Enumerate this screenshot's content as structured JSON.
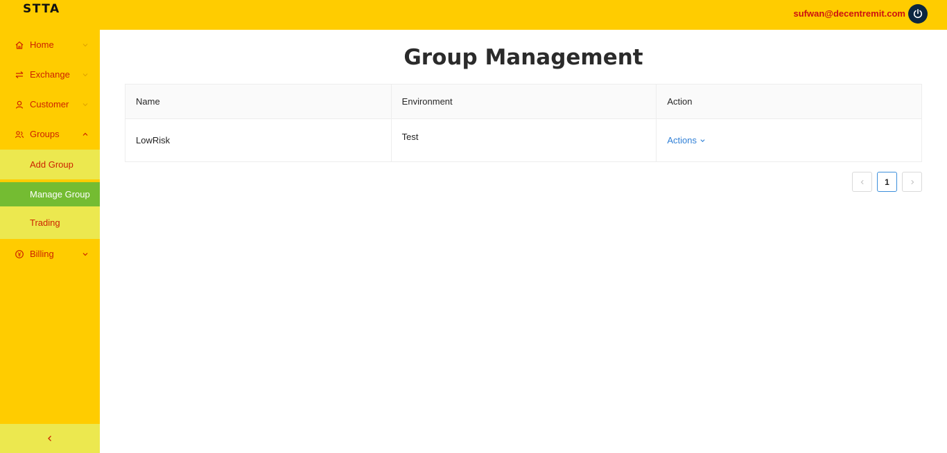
{
  "header": {
    "logo": "STTA",
    "user_email": "sufwan@decentremit.com"
  },
  "sidebar": {
    "items": [
      {
        "label": "Home",
        "icon": "home-icon"
      },
      {
        "label": "Exchange",
        "icon": "exchange-icon"
      },
      {
        "label": "Customer",
        "icon": "user-icon"
      },
      {
        "label": "Groups",
        "icon": "group-icon",
        "expanded": true,
        "children": [
          {
            "label": "Add Group"
          },
          {
            "label": "Manage Group",
            "active": true
          },
          {
            "label": "Trading"
          }
        ]
      },
      {
        "label": "Billing",
        "icon": "billing-icon"
      }
    ]
  },
  "main": {
    "title": "Group Management",
    "table": {
      "columns": [
        "Name",
        "Environment",
        "Action"
      ],
      "rows": [
        {
          "name": "LowRisk",
          "environment": "Test",
          "action_label": "Actions"
        }
      ]
    },
    "pagination": {
      "current_page": "1"
    }
  },
  "colors": {
    "sidebar_bg": "#ffcc00",
    "submenu_bg": "#ece84f",
    "active_bg": "#74bc32",
    "nav_text": "#cc2200",
    "link": "#2f7fd6"
  }
}
